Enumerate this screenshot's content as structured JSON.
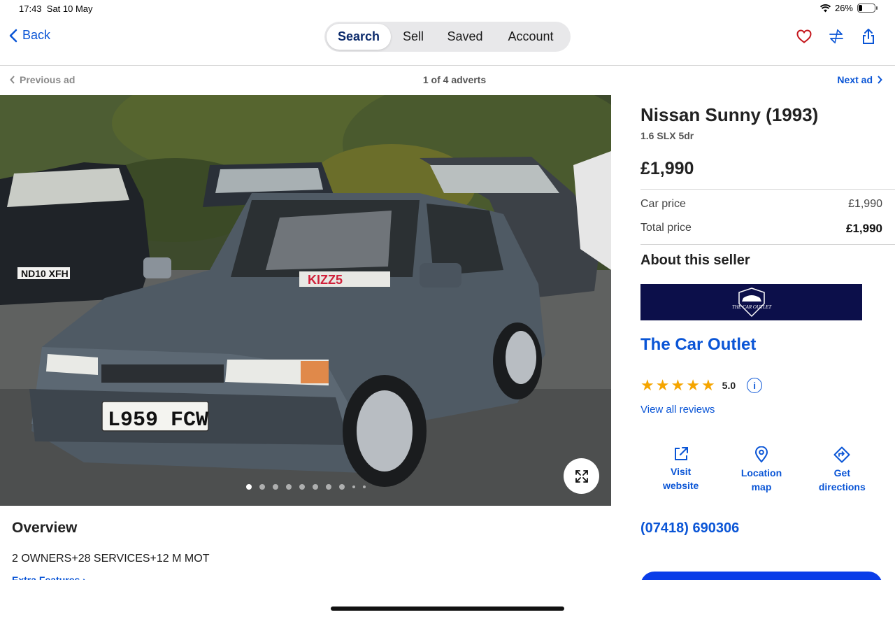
{
  "status_bar": {
    "time": "17:43",
    "date": "Sat 10 May",
    "battery": "26%",
    "battery_level": 0.26
  },
  "nav": {
    "back_label": "Back",
    "tabs": [
      {
        "label": "Search",
        "active": true
      },
      {
        "label": "Sell",
        "active": false
      },
      {
        "label": "Saved",
        "active": false
      },
      {
        "label": "Account",
        "active": false
      }
    ],
    "icons": [
      "heart-icon",
      "compare-icon",
      "share-icon"
    ]
  },
  "ad_nav": {
    "previous": "Previous ad",
    "count": "1 of 4 adverts",
    "next": "Next ad"
  },
  "gallery": {
    "image_count": 10,
    "current_index": 0,
    "plate_front": "L959 FCW",
    "plate_back": "ND10 XFH",
    "dealer_sign": "KIZZ5"
  },
  "overview": {
    "title": "Overview",
    "text": "2 OWNERS+28 SERVICES+12 M MOT",
    "link": "Extra Features"
  },
  "listing": {
    "title": "Nissan Sunny (1993)",
    "subtitle": "1.6 SLX 5dr",
    "price": "£1,990",
    "car_price_label": "Car price",
    "car_price_value": "£1,990",
    "total_price_label": "Total price",
    "total_price_value": "£1,990"
  },
  "seller": {
    "section_title": "About this seller",
    "logo_text": "THE CAR OUTLET",
    "name": "The Car Outlet",
    "rating": "5.0",
    "rating_stars": 5,
    "reviews_link": "View all reviews",
    "actions": [
      {
        "label": "Visit website",
        "icon": "external-link-icon"
      },
      {
        "label": "Location map",
        "icon": "map-pin-icon"
      },
      {
        "label": "Get directions",
        "icon": "directions-icon"
      }
    ],
    "phone": "(07418) 690306"
  },
  "colors": {
    "accent": "#0a55d6",
    "brand_dark": "#0c0f4a",
    "star": "#f5a500",
    "heart": "#c4161c"
  }
}
